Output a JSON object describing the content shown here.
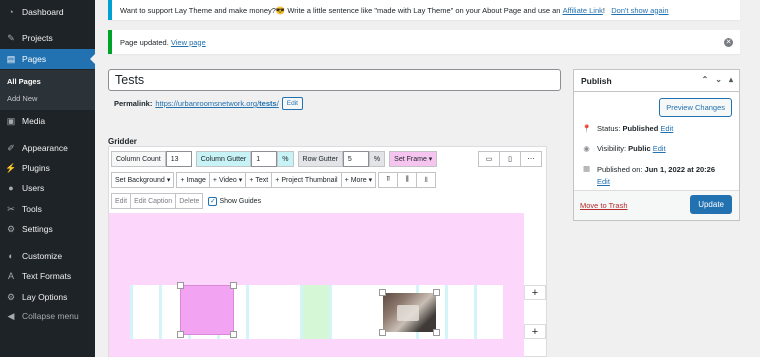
{
  "sidebar": {
    "items": [
      {
        "label": "Dashboard",
        "icon": "dashboard-icon"
      },
      {
        "label": "Projects",
        "icon": "projects-icon"
      },
      {
        "label": "Pages",
        "icon": "pages-icon"
      },
      {
        "label": "Media",
        "icon": "media-icon"
      },
      {
        "label": "Appearance",
        "icon": "appearance-icon"
      },
      {
        "label": "Plugins",
        "icon": "plugins-icon"
      },
      {
        "label": "Users",
        "icon": "users-icon"
      },
      {
        "label": "Tools",
        "icon": "tools-icon"
      },
      {
        "label": "Settings",
        "icon": "settings-icon"
      },
      {
        "label": "Customize",
        "icon": "customize-icon"
      },
      {
        "label": "Text Formats",
        "icon": "text-formats-icon"
      },
      {
        "label": "Lay Options",
        "icon": "gear-icon"
      },
      {
        "label": "Collapse menu",
        "icon": "collapse-icon"
      }
    ],
    "submenu": [
      "All Pages",
      "Add New"
    ],
    "accent": "#2271b1"
  },
  "notices": {
    "support_text": "Want to support Lay Theme and make money?😎 Write a little sentence like \"made with Lay Theme\" on your About Page and use an",
    "affiliate_link": "Affiliate Link",
    "exclaim": "!",
    "dont_show": "Don't show again",
    "updated_text": "Page updated.",
    "view_page": "View page"
  },
  "editor": {
    "title": "Tests",
    "permalink_label": "Permalink:",
    "permalink_url_prefix": "https://urbanroomsnetwork.org/",
    "permalink_slug": "tests",
    "permalink_url_suffix": "/",
    "edit_label": "Edit"
  },
  "publish": {
    "title": "Publish",
    "preview": "Preview Changes",
    "status_label": "Status:",
    "status_value": "Published",
    "visibility_label": "Visibility:",
    "visibility_value": "Public",
    "published_label": "Published on:",
    "published_value": "Jun 1, 2022 at 20:26",
    "edit": "Edit",
    "trash": "Move to Trash",
    "update": "Update"
  },
  "gridder": {
    "label": "Gridder",
    "column_count_label": "Column Count",
    "column_count": "13",
    "column_gutter_label": "Column Gutter",
    "column_gutter": "1",
    "row_gutter_label": "Row Gutter",
    "row_gutter": "5",
    "percent": "%",
    "set_frame": "Set Frame",
    "set_background": "Set Background",
    "image": "Image",
    "video": "Video",
    "text": "Text",
    "project_thumbnail": "Project Thumbnail",
    "more": "More",
    "edit": "Edit",
    "edit_caption": "Edit Caption",
    "delete": "Delete",
    "show_guides": "Show Guides"
  }
}
